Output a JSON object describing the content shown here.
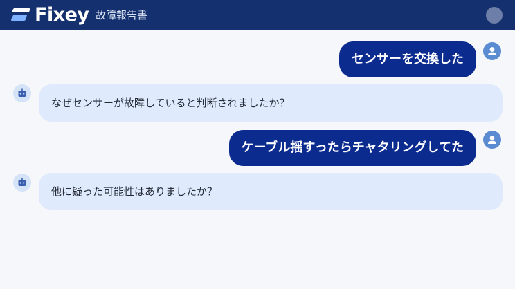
{
  "header": {
    "brand": "Fixey",
    "doc_title": "故障報告書",
    "logo_icon": "fixey-logo-icon",
    "avatar_icon": "user-avatar-icon"
  },
  "colors": {
    "header_bg": "#14306e",
    "user_bubble": "#0c2b8f",
    "bot_bubble": "#dfeafc",
    "page_bg": "#f6f7fa"
  },
  "chat": {
    "messages": [
      {
        "role": "user",
        "text": "センサーを交換した",
        "avatar_icon": "user-icon"
      },
      {
        "role": "bot",
        "text": "なぜセンサーが故障していると判断されましたか？",
        "avatar_icon": "robot-icon"
      },
      {
        "role": "user",
        "text": "ケーブル揺すったらチャタリングしてた",
        "avatar_icon": "user-icon"
      },
      {
        "role": "bot",
        "text": "他に疑った可能性はありましたか？",
        "avatar_icon": "robot-icon"
      }
    ]
  }
}
